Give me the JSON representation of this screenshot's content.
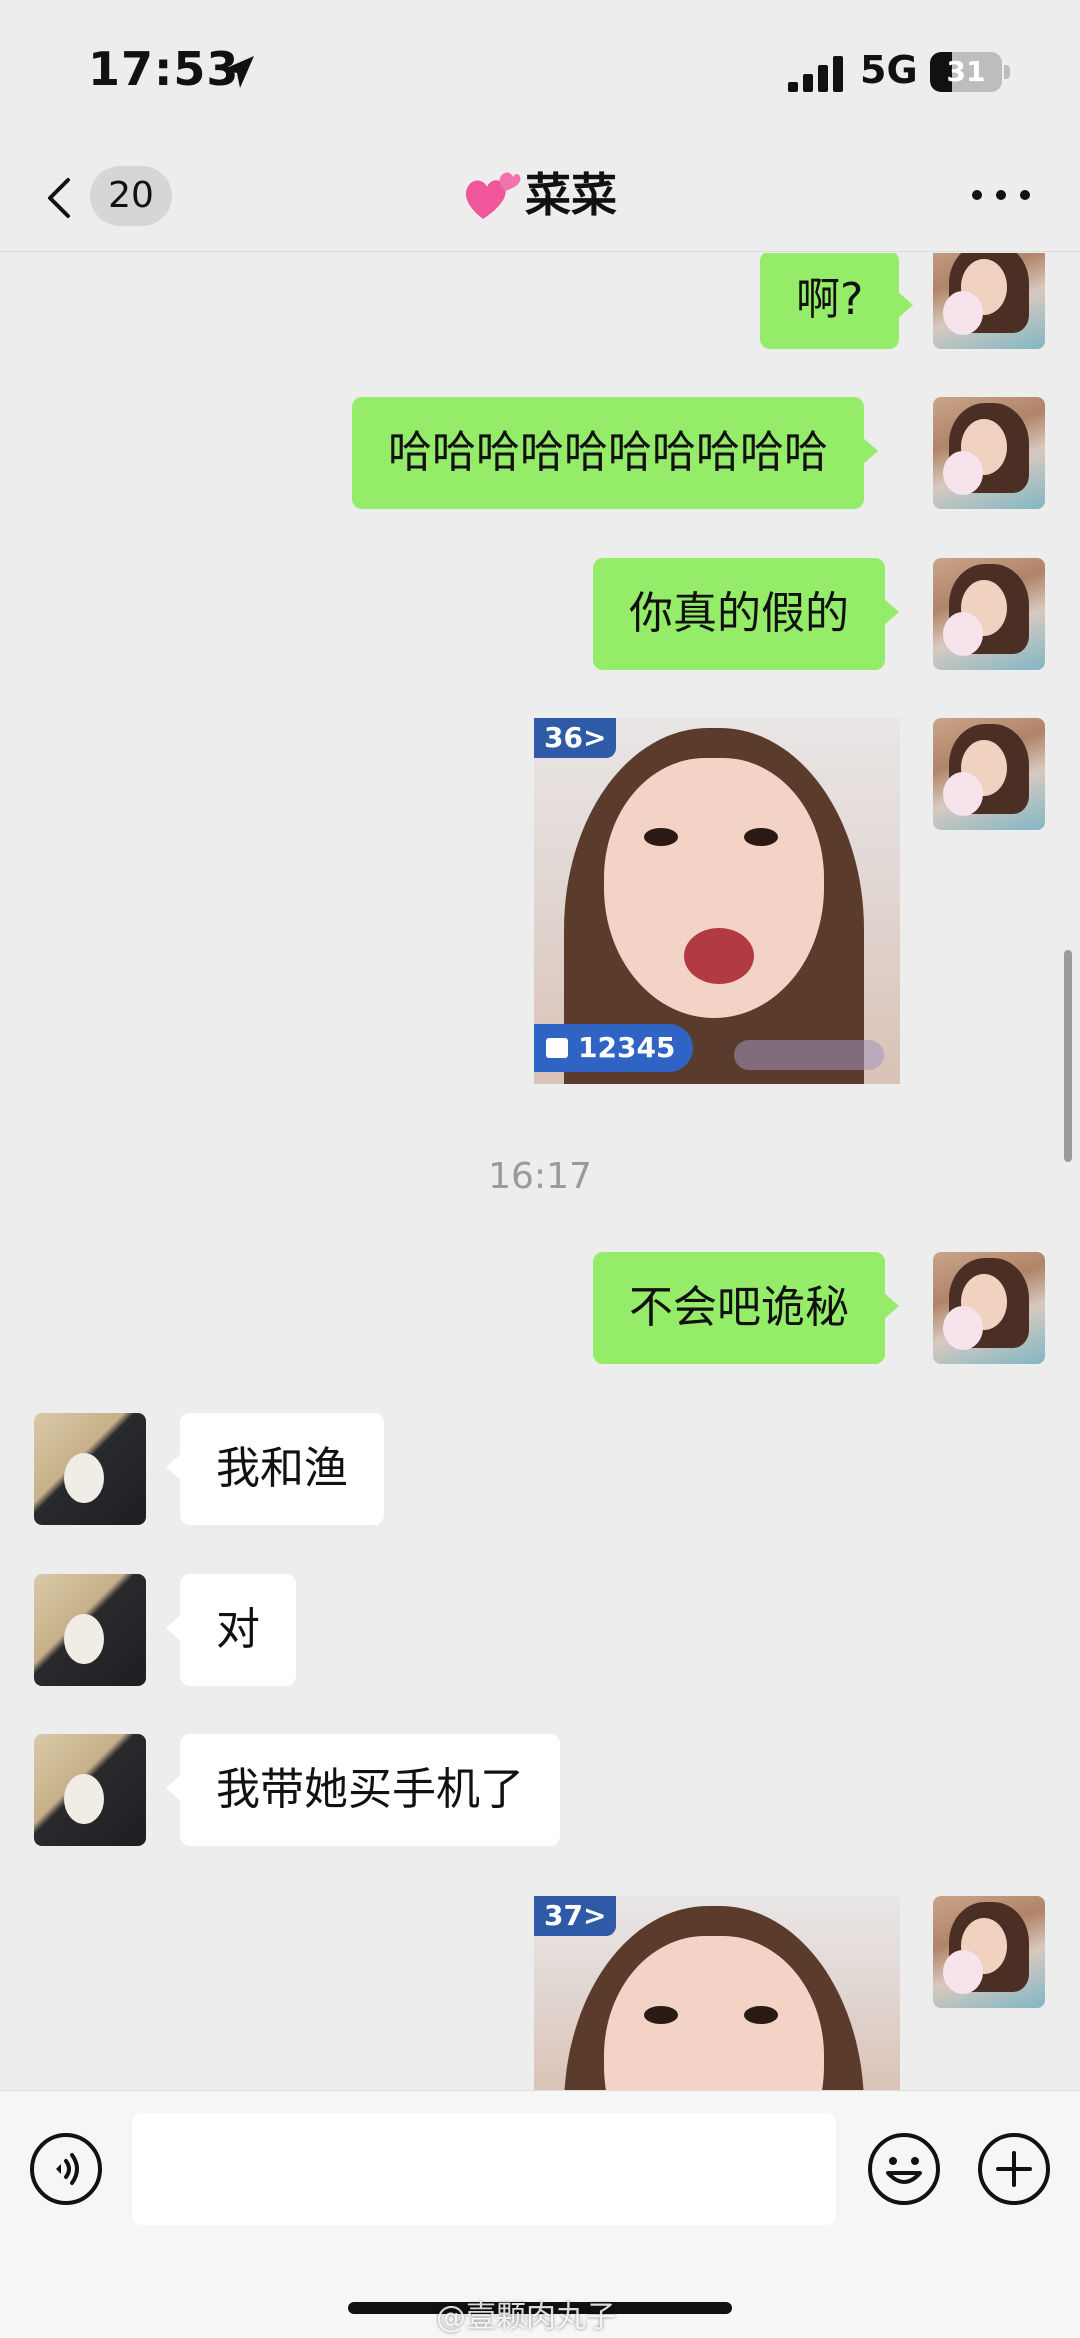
{
  "status_bar": {
    "time": "17:53",
    "network": "5G",
    "battery": "31",
    "battery_level": 0.31
  },
  "header": {
    "back_badge": "20",
    "title": "菜菜",
    "title_icon": "two-hearts-icon"
  },
  "messages": [
    {
      "side": "me",
      "type": "text",
      "text": "啊?"
    },
    {
      "side": "me",
      "type": "text",
      "text": "哈哈哈哈哈哈哈哈哈哈"
    },
    {
      "side": "me",
      "type": "text",
      "text": "你真的假的"
    },
    {
      "side": "me",
      "type": "image",
      "tag": "36>",
      "counter": "12345"
    },
    {
      "type": "timestamp",
      "text": "16:17"
    },
    {
      "side": "me",
      "type": "text",
      "text": "不会吧诡秘"
    },
    {
      "side": "other",
      "type": "text",
      "text": "我和渔"
    },
    {
      "side": "other",
      "type": "text",
      "text": "对"
    },
    {
      "side": "other",
      "type": "text",
      "text": "我带她买手机了"
    },
    {
      "side": "me",
      "type": "image",
      "tag": "37>"
    }
  ],
  "input_bar": {
    "input_value": "",
    "voice_icon": "voice-icon",
    "emoji_icon": "emoji-icon",
    "plus_icon": "plus-icon"
  },
  "watermark": "@壹颗肉丸子",
  "colors": {
    "background": "#ededed",
    "bubble_me": "#95ec69",
    "bubble_other": "#ffffff"
  }
}
